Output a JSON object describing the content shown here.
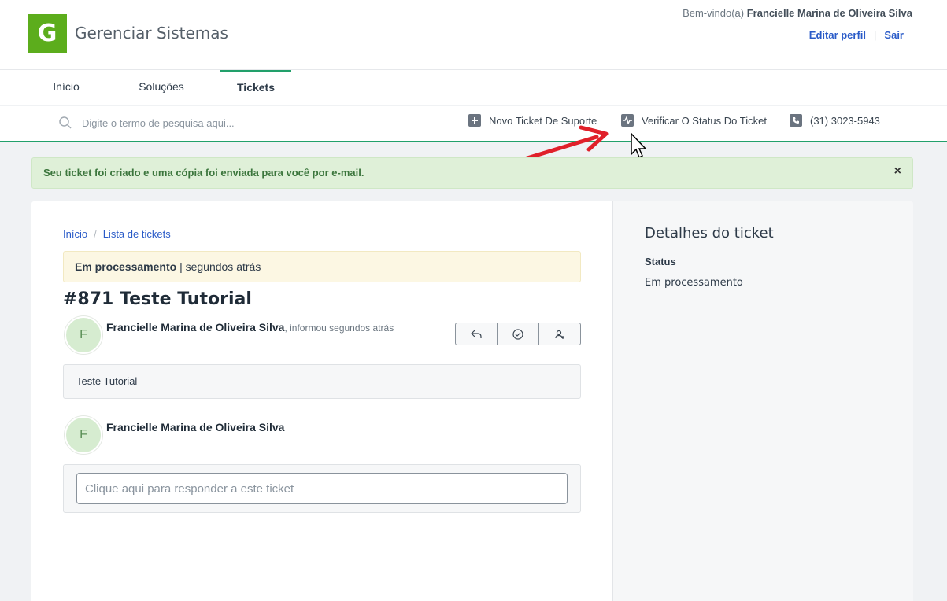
{
  "header": {
    "logo_letter": "G",
    "brand": "Gerenciar Sistemas",
    "welcome_prefix": "Bem-vindo(a)",
    "user_name": "Francielle Marina de Oliveira Silva",
    "edit_profile": "Editar perfil",
    "separator": "|",
    "logout": "Sair"
  },
  "nav": {
    "tabs": [
      {
        "label": "Início"
      },
      {
        "label": "Soluções"
      },
      {
        "label": "Tickets",
        "active": true
      }
    ]
  },
  "toolbar": {
    "search_placeholder": "Digite o termo de pesquisa aqui...",
    "new_ticket": "Novo Ticket De Suporte",
    "check_status": "Verificar O Status Do Ticket",
    "phone": "(31) 3023-5943"
  },
  "alert": {
    "text": "Seu ticket foi criado e uma cópia foi enviada para você por e-mail.",
    "close": "×"
  },
  "breadcrumb": {
    "home": "Início",
    "separator": "/",
    "list": "Lista de tickets"
  },
  "ticket": {
    "status": "Em processamento",
    "status_sep": "|",
    "status_time": "segundos atrás",
    "title": "#871 Teste Tutorial",
    "author": "Francielle Marina de Oliveira Silva",
    "author_meta": ", informou segundos atrás",
    "avatar_initial": "F",
    "message": "Teste Tutorial",
    "reply_author": "Francielle Marina de Oliveira Silva",
    "reply_placeholder": "Clique aqui para responder a este ticket"
  },
  "details": {
    "title": "Detalhes do ticket",
    "status_label": "Status",
    "status_value": "Em processamento"
  },
  "colors": {
    "brand_green": "#5cad1c",
    "nav_accent": "#22a06b",
    "link_blue": "#2a5bc8",
    "alert_bg": "#dff0d8",
    "status_bg": "#fcf7e3",
    "annotation_red": "#e0202a"
  },
  "icons": [
    "search-icon",
    "plus-icon",
    "activity-icon",
    "phone-icon",
    "reply-icon",
    "check-circle-icon",
    "assign-user-icon",
    "annotation-arrow",
    "mouse-cursor"
  ]
}
